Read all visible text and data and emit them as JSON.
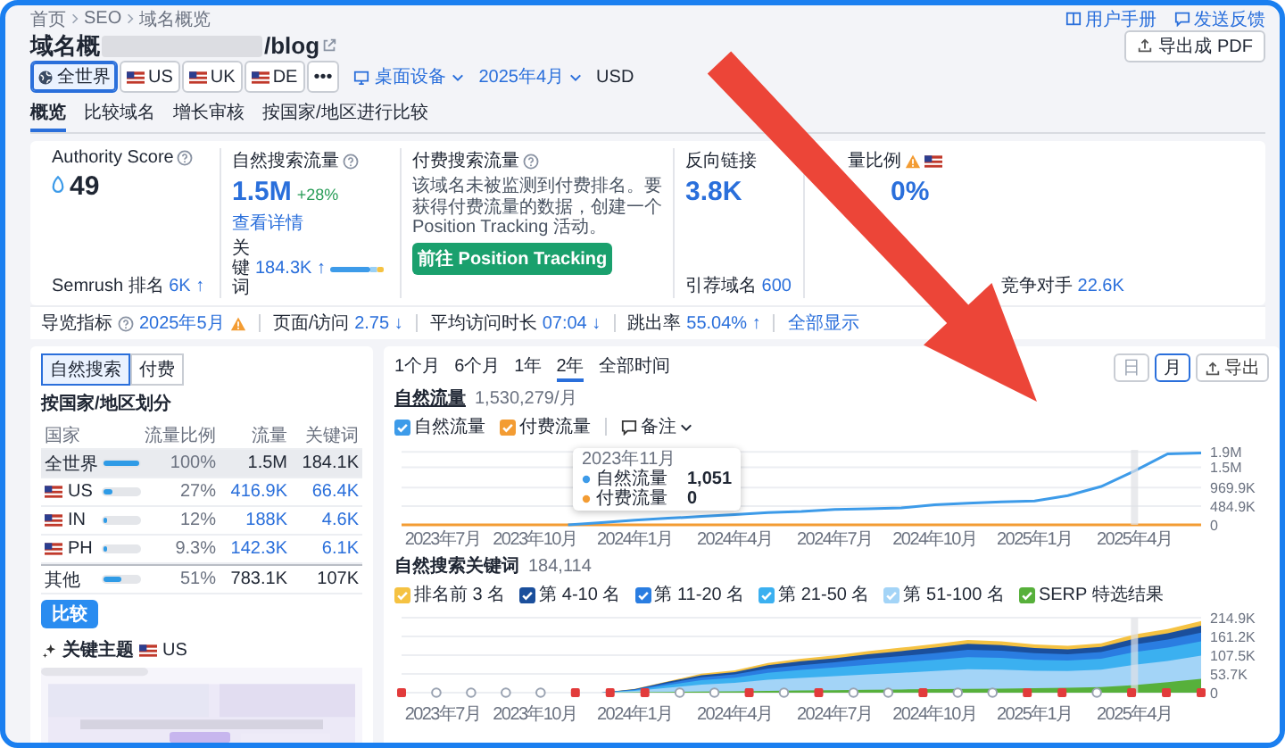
{
  "breadcrumb": [
    {
      "label": "首页"
    },
    {
      "label": "SEO"
    },
    {
      "label": "域名概览"
    }
  ],
  "help_links": [
    {
      "kind": "book",
      "label": "用户手册"
    },
    {
      "kind": "chat",
      "label": "发送反馈"
    }
  ],
  "title": {
    "prefix": "域名概",
    "suffix": "/blog"
  },
  "export_pdf": "导出成 PDF",
  "regions": [
    {
      "kind": "globe",
      "label": "全世界",
      "selected": true
    },
    {
      "kind": "flag",
      "label": "US",
      "selected": false
    },
    {
      "kind": "flag",
      "label": "UK",
      "selected": false
    },
    {
      "kind": "flag",
      "label": "DE",
      "selected": false
    },
    {
      "kind": "more",
      "label": "•••",
      "selected": false
    }
  ],
  "device": "桌面设备",
  "month": "2025年4月",
  "currency": "USD",
  "tabs": [
    {
      "label": "概览",
      "selected": true
    },
    {
      "label": "比较域名",
      "selected": false
    },
    {
      "label": "增长审核",
      "selected": false
    },
    {
      "label": "按国家/地区进行比较",
      "selected": false
    }
  ],
  "metrics": {
    "authority": {
      "label": "Authority Score",
      "value": "49",
      "footer_label": "Semrush 排名",
      "footer_value": "6K ↑"
    },
    "organic": {
      "label": "自然搜索流量",
      "value": "1.5M",
      "change": "+28%",
      "link": "查看详情",
      "keywords_label": "关键词",
      "keywords_value": "184.3K ↑"
    },
    "paid": {
      "label": "付费搜索流量",
      "text": "该域名未被监测到付费排名。要获得付费流量的数据，创建一个 Position Tracking 活动。",
      "button": "前往 Position Tracking"
    },
    "backlinks": {
      "label": "反向链接",
      "value": "3.8K",
      "footer_label": "引荐域名",
      "footer_value": "600"
    },
    "share": {
      "label": "量比例",
      "value": "0%",
      "footer_label": "竞争对手",
      "footer_value": "22.6K"
    }
  },
  "strip": {
    "items": [
      {
        "label": "导览指标",
        "value": "2025年5月",
        "info": true,
        "warning": true
      },
      {
        "label": "页面/访问",
        "value": "2.75 ↓",
        "info": false,
        "warning": false
      },
      {
        "label": "平均访问时长",
        "value": "07:04 ↓",
        "info": false,
        "warning": false
      },
      {
        "label": "跳出率",
        "value": "55.04% ↑",
        "info": false,
        "warning": false
      }
    ],
    "show_all": "全部显示"
  },
  "country_panel": {
    "toggle": [
      {
        "label": "自然搜索",
        "selected": true
      },
      {
        "label": "付费",
        "selected": false
      }
    ],
    "title": "按国家/地区划分",
    "columns": [
      "国家",
      "流量比例",
      "流量",
      "关键词"
    ],
    "rows": [
      {
        "kind": "total",
        "name": "全世界",
        "level": 1,
        "share": "100%",
        "traffic": "1.5M",
        "keywords": "184.1K",
        "selected": true
      },
      {
        "kind": "country",
        "name": "US",
        "level": 0.27,
        "share": "27%",
        "traffic": "416.9K",
        "keywords": "66.4K",
        "selected": false
      },
      {
        "kind": "country",
        "name": "IN",
        "level": 0.12,
        "share": "12%",
        "traffic": "188K",
        "keywords": "4.6K",
        "selected": false
      },
      {
        "kind": "country",
        "name": "PH",
        "level": 0.093,
        "share": "9.3%",
        "traffic": "142.3K",
        "keywords": "6.1K",
        "selected": false
      },
      {
        "kind": "other",
        "name": "其他",
        "level": 0.51,
        "share": "51%",
        "traffic": "783.1K",
        "keywords": "107K",
        "selected": false
      }
    ],
    "compare_button": "比较",
    "topics": {
      "title": "关键主题",
      "country": "US"
    }
  },
  "traffic": {
    "ranges": [
      {
        "label": "1个月",
        "selected": false
      },
      {
        "label": "6个月",
        "selected": false
      },
      {
        "label": "1年",
        "selected": false
      },
      {
        "label": "2年",
        "selected": true
      },
      {
        "label": "全部时间",
        "selected": false
      }
    ],
    "views": [
      {
        "label": "日",
        "selected": false
      },
      {
        "label": "月",
        "selected": true
      }
    ],
    "export": "导出",
    "title": "自然流量",
    "total": "1,530,279/月",
    "legend_checked": [
      true,
      true
    ],
    "notes": "备注",
    "tooltip": {
      "title": "2023年11月",
      "rows": [
        {
          "name": "自然流量",
          "value": "1,051"
        },
        {
          "name": "付费流量",
          "value": "0"
        }
      ]
    },
    "chart_data": {
      "type": "line",
      "categories": [
        null,
        "2023年7月",
        null,
        null,
        "2023年10月",
        null,
        null,
        "2024年1月",
        null,
        null,
        "2024年4月",
        null,
        null,
        "2024年7月",
        null,
        null,
        "2024年10月",
        null,
        null,
        "2025年1月",
        null,
        null,
        "2025年4月",
        null,
        null
      ],
      "ylim": [
        0,
        1950000
      ],
      "yticks": [
        {
          "value": 0,
          "label": "0"
        },
        {
          "value": 484900,
          "label": "484.9K"
        },
        {
          "value": 969900,
          "label": "969.9K"
        },
        {
          "value": 1500000,
          "label": "1.5M"
        },
        {
          "value": 1900000,
          "label": "1.9M"
        }
      ],
      "series": [
        {
          "name": "自然流量",
          "color": "#3d9be9",
          "values": [
            null,
            null,
            null,
            null,
            null,
            0,
            60000,
            120000,
            170000,
            220000,
            270000,
            320000,
            350000,
            400000,
            420000,
            440000,
            520000,
            560000,
            600000,
            620000,
            760000,
            1000000,
            1400000,
            1850000,
            1870000
          ]
        },
        {
          "name": "付费流量",
          "color": "#f39c33",
          "values": [
            0,
            0,
            0,
            0,
            0,
            0,
            0,
            0,
            0,
            0,
            0,
            0,
            0,
            0,
            0,
            0,
            0,
            0,
            0,
            0,
            0,
            0,
            0,
            0,
            0
          ]
        }
      ],
      "grid": true
    }
  },
  "keywords": {
    "title": "自然搜索关键词",
    "total": "184,114",
    "legend_checked": [
      true,
      true,
      true,
      true,
      true,
      true
    ],
    "chart_data": {
      "type": "area",
      "stacked": false,
      "categories": [
        null,
        "2023年7月",
        null,
        null,
        "2023年10月",
        null,
        null,
        "2024年1月",
        null,
        null,
        "2024年4月",
        null,
        null,
        "2024年7月",
        null,
        null,
        "2024年10月",
        null,
        null,
        "2025年1月",
        null,
        null,
        "2025年4月",
        null,
        null
      ],
      "ylim": [
        0,
        214900
      ],
      "yticks": [
        {
          "value": 0,
          "label": "0"
        },
        {
          "value": 53700,
          "label": "53.7K"
        },
        {
          "value": 107500,
          "label": "107.5K"
        },
        {
          "value": 161200,
          "label": "161.2K"
        },
        {
          "value": 214900,
          "label": "214.9K"
        }
      ],
      "series": [
        {
          "name": "排名前 3 名",
          "color": "#f5c242",
          "values": [
            0,
            0,
            0,
            0,
            0,
            0,
            0,
            11000,
            33000,
            54000,
            64000,
            85000,
            97000,
            107000,
            119000,
            129000,
            139000,
            151000,
            147000,
            138000,
            134000,
            141000,
            167000,
            182000,
            205000
          ]
        },
        {
          "name": "第 4-10 名",
          "color": "#1b4f9c",
          "values": [
            0,
            0,
            0,
            0,
            0,
            0,
            0,
            10000,
            31000,
            50000,
            59000,
            79000,
            90000,
            99000,
            110000,
            119000,
            129000,
            140000,
            136000,
            128000,
            124000,
            131000,
            155000,
            170000,
            192000
          ]
        },
        {
          "name": "第 11-20 名",
          "color": "#2a7de1",
          "values": [
            0,
            0,
            0,
            0,
            0,
            0,
            0,
            9000,
            27000,
            44000,
            52000,
            69000,
            79000,
            87000,
            97000,
            105000,
            113000,
            123000,
            120000,
            113000,
            110000,
            116000,
            138000,
            152000,
            172000
          ]
        },
        {
          "name": "第 21-50 名",
          "color": "#3bb0f0",
          "values": [
            0,
            0,
            0,
            0,
            0,
            0,
            0,
            7000,
            22000,
            36000,
            43000,
            57000,
            65000,
            72000,
            80000,
            87000,
            94000,
            102000,
            100000,
            94000,
            92000,
            97000,
            116000,
            129000,
            147000
          ]
        },
        {
          "name": "第 51-100 名",
          "color": "#a3d4f7",
          "values": [
            0,
            0,
            0,
            0,
            0,
            0,
            0,
            5000,
            14000,
            23000,
            28000,
            37000,
            42000,
            47000,
            52000,
            57000,
            62000,
            67000,
            66000,
            63000,
            62000,
            66000,
            80000,
            91000,
            106000
          ]
        },
        {
          "name": "SERP 特选结果",
          "color": "#57b03b",
          "values": [
            0,
            0,
            0,
            0,
            0,
            0,
            0,
            1000,
            2000,
            3000,
            4000,
            5000,
            6000,
            7000,
            8000,
            9000,
            10000,
            11000,
            12000,
            13000,
            14000,
            16000,
            22000,
            30000,
            40000
          ]
        }
      ],
      "grid": true
    },
    "markers": [
      {
        "kind": "flag"
      },
      {
        "kind": "circle"
      },
      {
        "kind": "circle"
      },
      {
        "kind": "circle"
      },
      {
        "kind": "circle"
      },
      {
        "kind": "flag"
      },
      {
        "kind": "flag"
      },
      {
        "kind": "flag"
      },
      {
        "kind": "circle"
      },
      {
        "kind": "circle"
      },
      {
        "kind": "flag"
      },
      {
        "kind": "circle"
      },
      {
        "kind": "flag"
      },
      {
        "kind": "circle"
      },
      {
        "kind": "circle"
      },
      {
        "kind": "flag"
      },
      {
        "kind": "circle"
      },
      {
        "kind": "circle"
      },
      {
        "kind": "flag"
      },
      {
        "kind": "flag"
      },
      {
        "kind": "circle"
      },
      {
        "kind": "flag"
      },
      {
        "kind": "flag"
      },
      {
        "kind": "flag"
      }
    ]
  }
}
